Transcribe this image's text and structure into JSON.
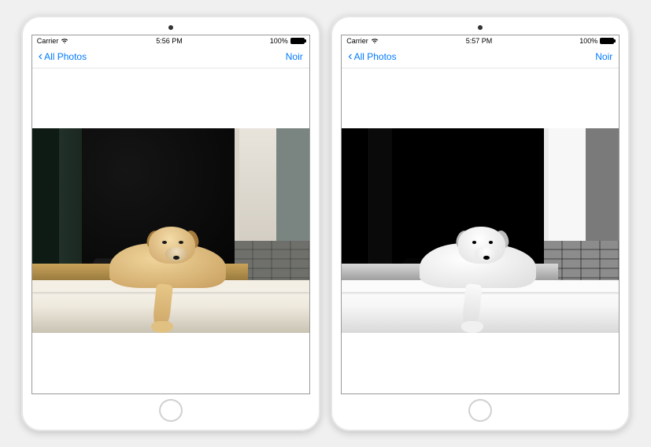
{
  "devices": [
    {
      "status": {
        "carrier": "Carrier",
        "time": "5:56 PM",
        "battery": "100%"
      },
      "nav": {
        "back_label": "All Photos",
        "action_label": "Noir"
      },
      "photo": {
        "variant": "color",
        "subject": "dog-on-porch"
      }
    },
    {
      "status": {
        "carrier": "Carrier",
        "time": "5:57 PM",
        "battery": "100%"
      },
      "nav": {
        "back_label": "All Photos",
        "action_label": "Noir"
      },
      "photo": {
        "variant": "noir",
        "subject": "dog-on-porch"
      }
    }
  ]
}
